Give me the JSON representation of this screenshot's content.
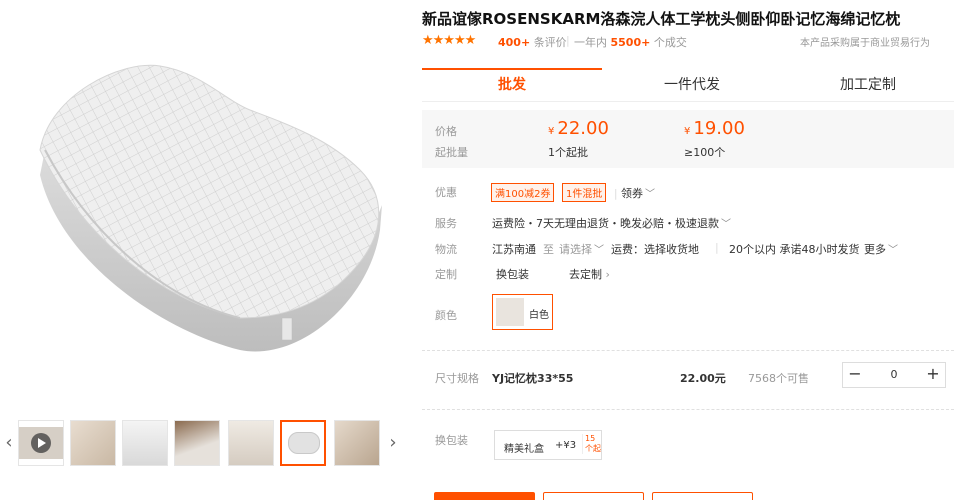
{
  "product": {
    "title": "新品谊傢ROSENSKARM洛森浣人体工学枕头侧卧仰卧记忆海绵记忆枕",
    "rating_count": "400+",
    "rating_label": "条评价",
    "year_label": "一年内",
    "sold_count": "5500+",
    "sold_label": "个成交",
    "trade_note": "本产品采购属于商业贸易行为"
  },
  "gallery": {
    "thumbs": [
      "video-thumb",
      "packaging-thumb",
      "pillow-side-thumb",
      "pillow-bed-thumb",
      "pillow-box-thumb",
      "pillow-white-thumb",
      "pillow-pack-thumb"
    ],
    "active_index": 5
  },
  "tabs": [
    {
      "label": "批发"
    },
    {
      "label": "一件代发"
    },
    {
      "label": "加工定制"
    }
  ],
  "pricing": {
    "price_label": "价格",
    "moq_label": "起批量",
    "currency": "¥",
    "tier1_price": "22.00",
    "tier1_moq": "1个起批",
    "tier2_price": "19.00",
    "tier2_moq": "≥100个"
  },
  "details": {
    "promo_label": "优惠",
    "promo_tag1": "满100减2券",
    "promo_tag2": "1件混批",
    "promo_coupon": "领券",
    "service_label": "服务",
    "service_text": "运费险・7天无理由退货・晚发必赔・极速退款",
    "logistics_label": "物流",
    "logistics_from": "江苏南通",
    "logistics_to": "至",
    "logistics_select": "请选择",
    "logistics_fee": "运费：选择收货地",
    "logistics_ship": "20个以内 承诺48小时发货",
    "logistics_more": "更多",
    "custom_label": "定制",
    "custom_opt1": "换包装",
    "custom_opt2": "去定制",
    "color_label": "颜色",
    "color_value": "白色"
  },
  "sku": {
    "label": "尺寸规格",
    "name": "YJ记忆枕33*55",
    "price": "22.00元",
    "stock": "7568个可售",
    "qty": "0"
  },
  "packing": {
    "label": "换包装",
    "option_name": "精美礼盒",
    "option_price": "+¥3",
    "option_min": "15个起"
  },
  "colors": {
    "accent": "#ff5000",
    "star": "#ff7300",
    "price_bg": "#f7f7f7"
  }
}
